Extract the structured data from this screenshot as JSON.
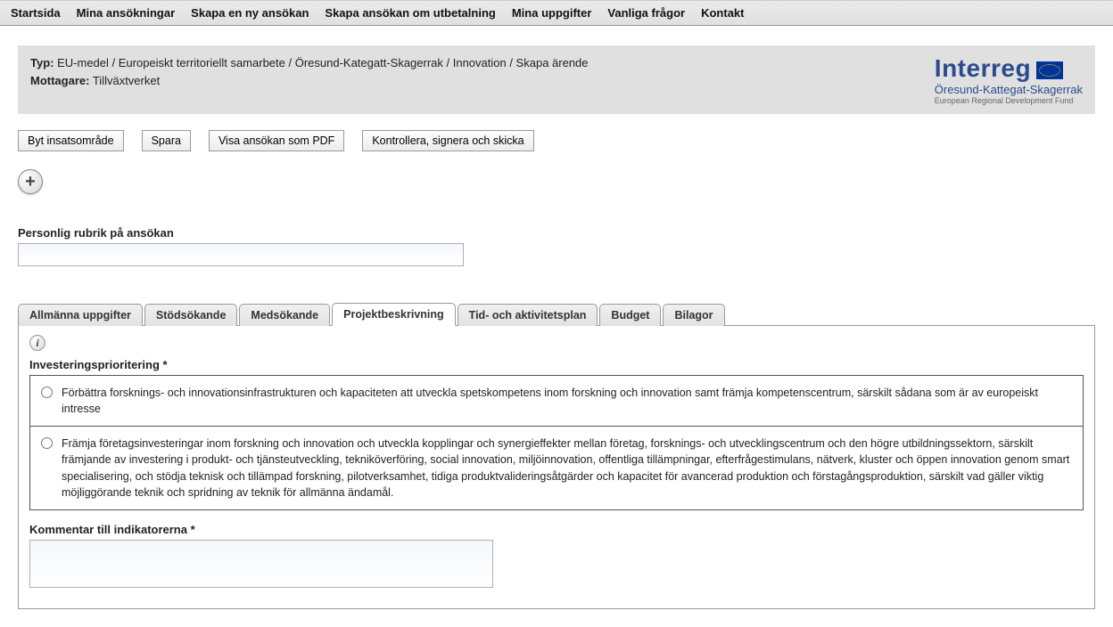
{
  "nav": {
    "items": [
      "Startsida",
      "Mina ansökningar",
      "Skapa en ny ansökan",
      "Skapa ansökan om utbetalning",
      "Mina uppgifter",
      "Vanliga frågor",
      "Kontakt"
    ]
  },
  "info": {
    "type_label": "Typ:",
    "type_value": "EU-medel / Europeiskt territoriellt samarbete / Öresund-Kategatt-Skagerrak / Innovation / Skapa ärende",
    "recipient_label": "Mottagare:",
    "recipient_value": "Tillväxtverket"
  },
  "logo": {
    "word": "Interreg",
    "sub": "Öresund-Kattegat-Skagerrak",
    "sub2": "European Regional Development Fund"
  },
  "buttons": {
    "change_area": "Byt insatsområde",
    "save": "Spara",
    "view_pdf": "Visa ansökan som PDF",
    "submit": "Kontrollera, signera och skicka"
  },
  "fields": {
    "personal_title_label": "Personlig rubrik på ansökan",
    "personal_title_value": ""
  },
  "tabs": [
    "Allmänna uppgifter",
    "Stödsökande",
    "Medsökande",
    "Projektbeskrivning",
    "Tid- och aktivitetsplan",
    "Budget",
    "Bilagor"
  ],
  "active_tab_index": 3,
  "panel": {
    "invest_label": "Investeringsprioritering *",
    "options": [
      "Förbättra forsknings- och innovationsinfrastrukturen och kapaciteten att utveckla spetskompetens inom forskning och innovation samt främja kompetenscentrum, särskilt sådana som är av europeiskt intresse",
      "Främja företagsinvesteringar inom forskning och innovation och utveckla kopplingar och synergieffekter mellan företag, forsknings- och utvecklingscentrum och den högre utbildningssektorn, särskilt främjande av investering i produkt- och tjänsteutveckling, tekniköverföring, social innovation, miljöinnovation, offentliga tillämpningar, efterfrågestimulans, nätverk, kluster och öppen innovation genom smart specialisering, och stödja teknisk och tillämpad forskning, pilotverksamhet, tidiga produktvalideringsåtgärder och kapacitet för avancerad produktion och förstagångsproduktion, särskilt vad gäller viktig möjliggörande teknik och spridning av teknik för allmänna ändamål."
    ],
    "comment_label": "Kommentar till indikatorerna *",
    "comment_value": ""
  }
}
